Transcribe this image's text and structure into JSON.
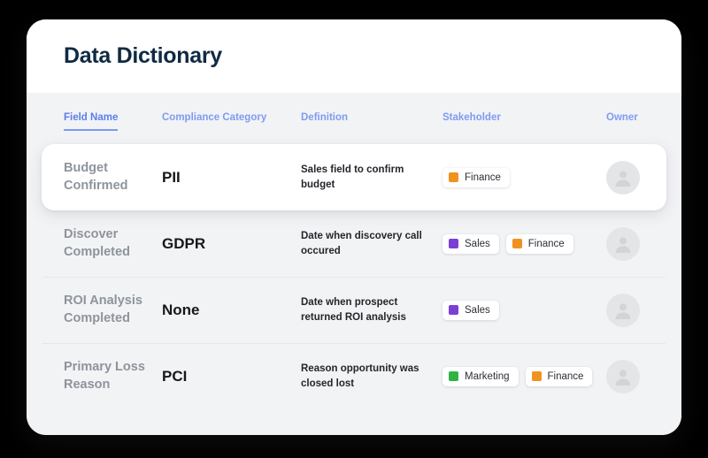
{
  "header": {
    "title": "Data Dictionary"
  },
  "table": {
    "columns": [
      {
        "label": "Field Name",
        "active": true
      },
      {
        "label": "Compliance Category",
        "active": false
      },
      {
        "label": "Definition",
        "active": false
      },
      {
        "label": "Stakeholder",
        "active": false
      },
      {
        "label": "Owner",
        "active": false
      }
    ],
    "rows": [
      {
        "field_name": "Budget Confirmed",
        "compliance_category": "PII",
        "definition": "Sales field to confirm budget",
        "stakeholders": [
          {
            "label": "Finance",
            "color": "#f0921f"
          }
        ],
        "owner": "avatar-placeholder",
        "highlighted": true
      },
      {
        "field_name": "Discover Completed",
        "compliance_category": "GDPR",
        "definition": "Date when discovery call occured",
        "stakeholders": [
          {
            "label": "Sales",
            "color": "#7b3fd4"
          },
          {
            "label": "Finance",
            "color": "#f0921f"
          }
        ],
        "owner": "avatar-placeholder",
        "highlighted": false
      },
      {
        "field_name": "ROI Analysis Completed",
        "compliance_category": "None",
        "definition": "Date when prospect returned ROI analysis",
        "stakeholders": [
          {
            "label": "Sales",
            "color": "#7b3fd4"
          }
        ],
        "owner": "avatar-placeholder",
        "highlighted": false
      },
      {
        "field_name": "Primary Loss Reason",
        "compliance_category": "PCI",
        "definition": "Reason opportunity was closed lost",
        "stakeholders": [
          {
            "label": "Marketing",
            "color": "#2fb344"
          },
          {
            "label": "Finance",
            "color": "#f0921f"
          }
        ],
        "owner": "avatar-placeholder",
        "highlighted": false
      }
    ]
  },
  "colors": {
    "accent": "#7a9bf5",
    "title": "#102a43",
    "page_background": "#000000",
    "card_background": "#ffffff",
    "table_background": "#f2f3f5"
  }
}
